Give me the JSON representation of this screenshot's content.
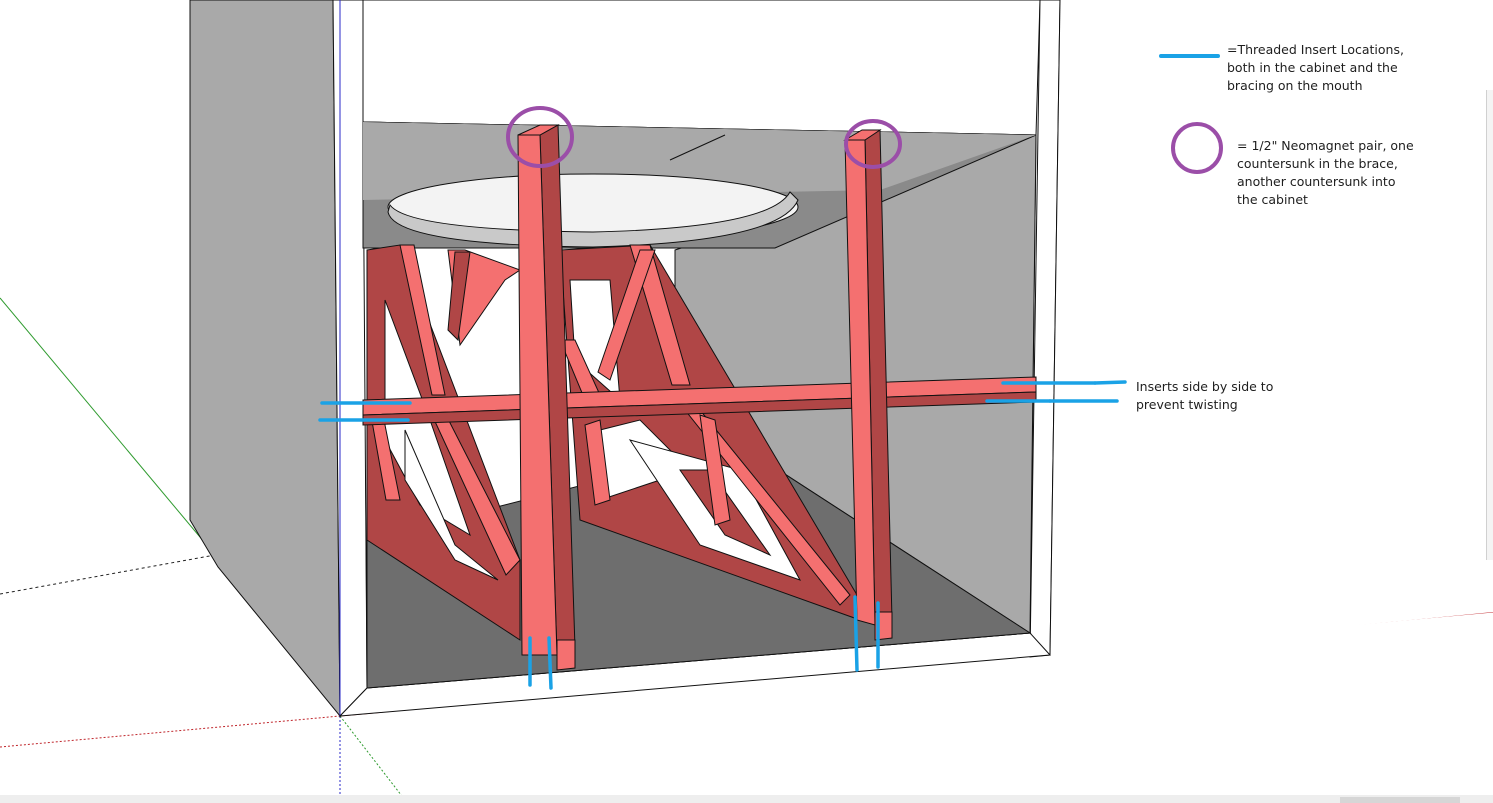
{
  "colors": {
    "brace_face": "#f47070",
    "brace_side": "#b04646",
    "insert_marker": "#1aa2e6",
    "magnet_marker": "#9b4ea8",
    "cabinet_light": "#a9a9a9",
    "cabinet_dark": "#6e6e6e",
    "axis_red": "#c0262c",
    "axis_green": "#2f9b2f",
    "axis_blue": "#2a2ac8"
  },
  "legend": {
    "insert_label": "=Threaded Insert Locations,\nboth in the cabinet and the\nbracing on the mouth",
    "insert_symbol": "blue-line-icon",
    "magnet_label": "= 1/2\" Neomagnet pair, one\ncountersunk in the brace,\nanother countersunk into\nthe cabinet",
    "magnet_symbol": "purple-circle-icon"
  },
  "annotations": {
    "side_by_side": "Inserts side by side to\nprevent twisting"
  }
}
